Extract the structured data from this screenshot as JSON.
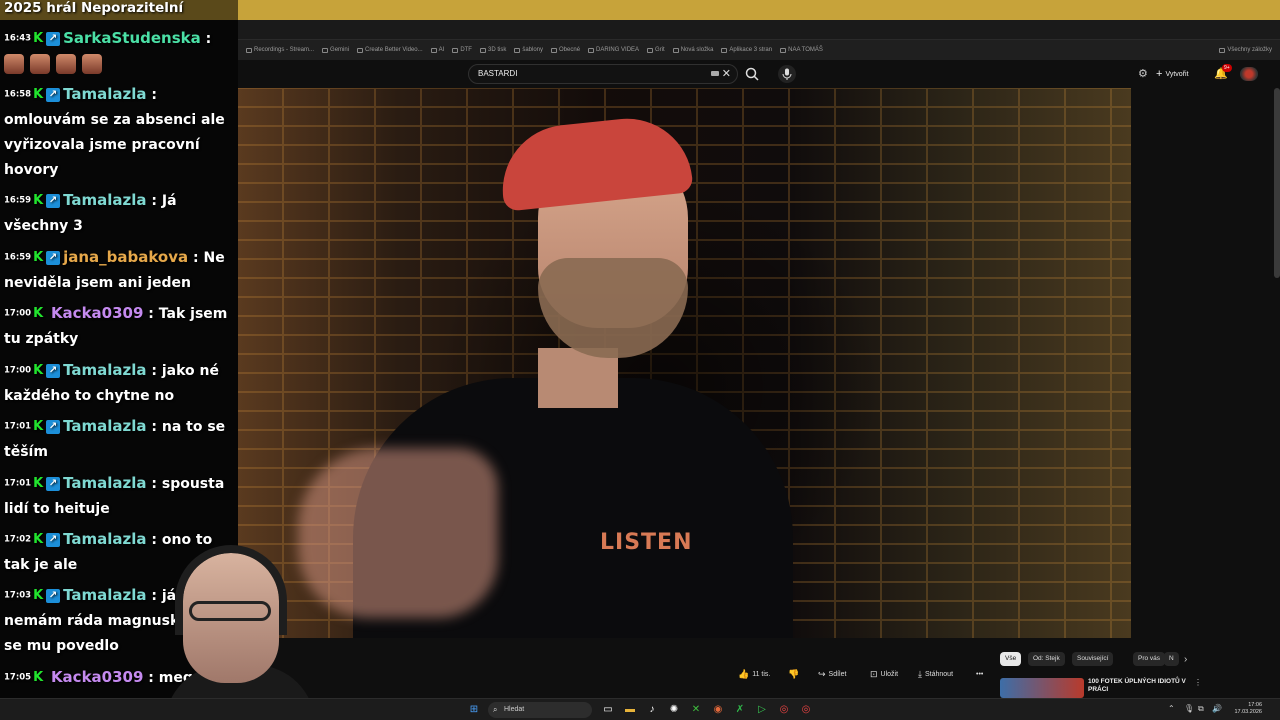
{
  "bookmarks": [
    "Recordings - Stream...",
    "Gemini",
    "Create Better Video...",
    "AI",
    "DTF",
    "3D tisk",
    "šablony",
    "Obecné",
    "DARING VIDEA",
    "Grit",
    "Nová složka",
    "Aplikace 3 stran",
    "NAA TOMÁŠ",
    "Všechny záložky"
  ],
  "yt": {
    "search_value": "BASTARDI",
    "create_label": "Vytvořit",
    "bell_badge": "9+"
  },
  "video": {
    "shirt_text": "LISTEN"
  },
  "actions": {
    "like_count": "11 tis.",
    "share_label": "Sdílet",
    "save_label": "Uložit",
    "download_label": "Stáhnout",
    "more_label": "•••"
  },
  "chips": [
    "Vše",
    "Od: Stejk",
    "Související",
    "Pro vás",
    "N"
  ],
  "recommendation": {
    "title": "100 FOTEK ÚPLNÝCH IDIOTŮ V PRÁCI"
  },
  "chat": {
    "title": "2025 hrál Neporazitelní",
    "messages": [
      {
        "time": "16:43",
        "user": "SarkaStudenska",
        "color": "#4be0a6",
        "text": ""
      },
      {
        "time": "16:58",
        "user": "Tamalazla",
        "color": "#7fd9d2",
        "text": "omlouvám se za absenci ale vyřizovala jsme pracovní hovory"
      },
      {
        "time": "16:59",
        "user": "Tamalazla",
        "color": "#7fd9d2",
        "text": "Já všechny 3"
      },
      {
        "time": "16:59",
        "user": "jana_babakova",
        "color": "#e6a84a",
        "text": "Ne neviděla jsem ani jeden"
      },
      {
        "time": "17:00",
        "user": "Kacka0309",
        "color": "#c58af0",
        "text": "Tak jsem tu zpátky"
      },
      {
        "time": "17:00",
        "user": "Tamalazla",
        "color": "#7fd9d2",
        "text": "jako né každého to chytne no"
      },
      {
        "time": "17:01",
        "user": "Tamalazla",
        "color": "#7fd9d2",
        "text": "na to se těším"
      },
      {
        "time": "17:01",
        "user": "Tamalazla",
        "color": "#7fd9d2",
        "text": "spousta lidí to heituje"
      },
      {
        "time": "17:02",
        "user": "Tamalazla",
        "color": "#7fd9d2",
        "text": "ono to tak je ale"
      },
      {
        "time": "17:03",
        "user": "Tamalazla",
        "color": "#7fd9d2",
        "text": "já nemám ráda magnuska tohle se mu povedlo"
      },
      {
        "time": "17:05",
        "user": "Kacka0309",
        "color": "#c58af0",
        "text": "mega"
      }
    ]
  },
  "taskbar": {
    "search_placeholder": "Hledat",
    "clock_time": "17:06",
    "clock_date": "17.03.2026"
  }
}
